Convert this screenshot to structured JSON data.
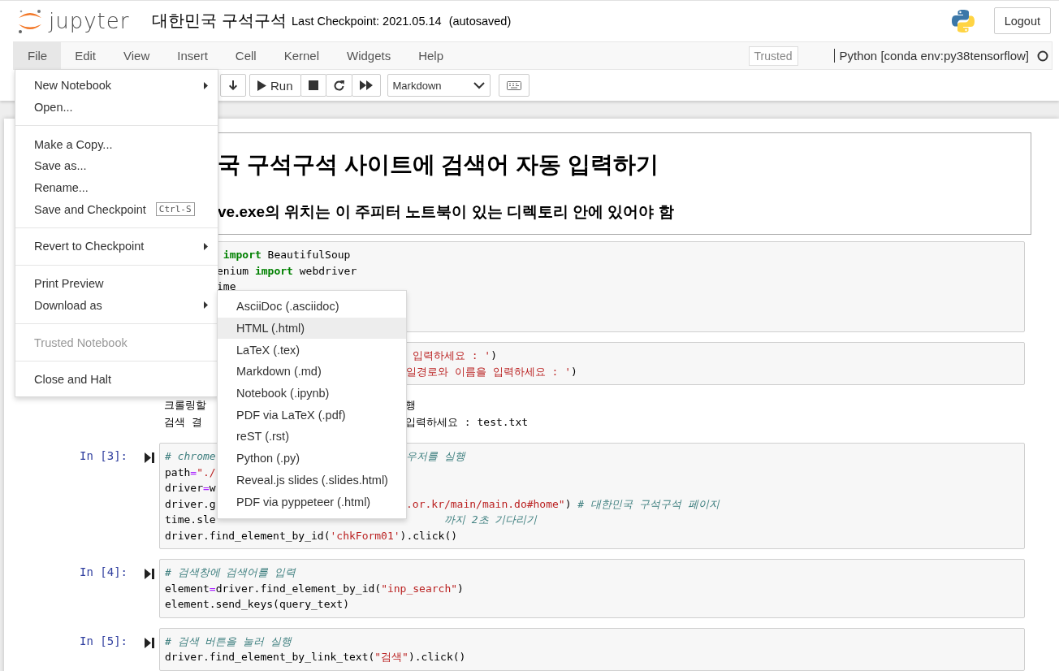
{
  "header": {
    "logo_text": "jupyter",
    "title": "대한민국 구석구석",
    "checkpoint": "Last Checkpoint: 2021.05.14",
    "autosave": "(autosaved)",
    "logout": "Logout"
  },
  "menubar": {
    "items": [
      {
        "label": "File",
        "selected": true
      },
      {
        "label": "Edit",
        "selected": false
      },
      {
        "label": "View",
        "selected": false
      },
      {
        "label": "Insert",
        "selected": false
      },
      {
        "label": "Cell",
        "selected": false
      },
      {
        "label": "Kernel",
        "selected": false
      },
      {
        "label": "Widgets",
        "selected": false
      },
      {
        "label": "Help",
        "selected": false
      }
    ],
    "trusted": "Trusted",
    "kernel": "Python [conda env:py38tensorflow]",
    "kernel_busy": false
  },
  "toolbar": {
    "run_label": "Run",
    "cell_type": "Markdown"
  },
  "cells": [
    {
      "kind": "markdown",
      "headings": [
        {
          "kind": "h1",
          "text": "국 구석구석 사이트에 검색어 자동 입력하기"
        },
        {
          "kind": "h3",
          "text": "ve.exe의 위치는 이 주피터 노트북이 있는 디렉토리 안에 있어야 함"
        }
      ]
    },
    {
      "kind": "code",
      "lines": [
        {
          "after_file_menu": [
            {
              "kind": "keyword",
              "text": " import"
            },
            {
              "kind": "plain",
              "text": " BeautifulSoup"
            }
          ]
        },
        {
          "after_file_menu": [
            {
              "kind": "plain",
              "text": "enium "
            },
            {
              "kind": "keyword",
              "text": "import"
            },
            {
              "kind": "plain",
              "text": " webdriver"
            }
          ]
        },
        {
          "after_file_menu": [
            {
              "kind": "plain",
              "text": "ime"
            }
          ]
        }
      ]
    },
    {
      "kind": "code",
      "lines": [
        {
          "after_submenu": [
            {
              "kind": "string",
              "text": " 입력하세요 : '"
            },
            {
              "kind": "plain",
              "text": ")"
            }
          ]
        },
        {
          "after_submenu": [
            {
              "kind": "string",
              "text": "일경로와 이름을 입력하세요 : '"
            },
            {
              "kind": "plain",
              "text": ")"
            }
          ]
        }
      ]
    },
    {
      "kind": "output",
      "lines": [
        {
          "start": [
            {
              "kind": "plain",
              "text": "크롤링할"
            }
          ],
          "after_submenu": [
            {
              "kind": "plain",
              "text": "행"
            }
          ]
        },
        {
          "start": [
            {
              "kind": "plain",
              "text": "검색 결"
            }
          ],
          "after_submenu": [
            {
              "kind": "plain",
              "text": "입력하세요 : test.txt"
            }
          ]
        }
      ]
    },
    {
      "kind": "code",
      "prompt": "In [3]:",
      "lines": [
        {
          "start": [
            {
              "kind": "comment",
              "text": "# chrome"
            }
          ],
          "after_submenu": [
            {
              "kind": "comment",
              "text": "우저를 실행"
            }
          ]
        },
        {
          "start": [
            {
              "kind": "plain",
              "text": "path"
            },
            {
              "kind": "operator",
              "text": "="
            },
            {
              "kind": "string",
              "text": "\"./"
            }
          ]
        },
        {
          "start": [
            {
              "kind": "plain",
              "text": "driver"
            },
            {
              "kind": "operator",
              "text": "="
            },
            {
              "kind": "plain",
              "text": "w"
            }
          ]
        },
        {
          "start": [
            {
              "kind": "plain",
              "text": "driver.g"
            }
          ],
          "after_submenu": [
            {
              "kind": "string",
              "text": ".or.kr/main/main.do#home\""
            },
            {
              "kind": "plain",
              "text": ") "
            },
            {
              "kind": "comment",
              "text": "# 대한민국 구석구석 페이지"
            }
          ]
        },
        {
          "start": [
            {
              "kind": "plain",
              "text": "time.sle"
            }
          ],
          "after_submenu": [
            {
              "kind": "comment",
              "text": "      까지 2초 기다리기"
            }
          ]
        },
        {
          "start": [
            {
              "kind": "plain",
              "text": "driver.find_element_by_id("
            },
            {
              "kind": "string",
              "text": "'chkForm01'"
            },
            {
              "kind": "plain",
              "text": ").click()"
            }
          ]
        }
      ]
    },
    {
      "kind": "code",
      "prompt": "In [4]:",
      "lines": [
        {
          "start": [
            {
              "kind": "comment",
              "text": "# 검색창에 검색어를 입력"
            }
          ]
        },
        {
          "start": [
            {
              "kind": "plain",
              "text": "element"
            },
            {
              "kind": "operator",
              "text": "="
            },
            {
              "kind": "plain",
              "text": "driver.find_element_by_id("
            },
            {
              "kind": "string",
              "text": "\"inp_search\""
            },
            {
              "kind": "plain",
              "text": ")"
            }
          ]
        },
        {
          "start": [
            {
              "kind": "plain",
              "text": "element.send_keys(query_text)"
            }
          ]
        }
      ]
    },
    {
      "kind": "code",
      "prompt": "In [5]:",
      "lines": [
        {
          "start": [
            {
              "kind": "comment",
              "text": "# 검색 버튼을 눌러 실행"
            }
          ]
        },
        {
          "start": [
            {
              "kind": "plain",
              "text": "driver.find_element_by_link_text("
            },
            {
              "kind": "string",
              "text": "\"검색\""
            },
            {
              "kind": "plain",
              "text": ").click()"
            }
          ]
        }
      ]
    }
  ],
  "file_menu": {
    "groups": [
      [
        {
          "label": "New Notebook",
          "submenu": true,
          "disabled": false
        },
        {
          "label": "Open...",
          "submenu": false,
          "disabled": false
        }
      ],
      [
        {
          "label": "Make a Copy...",
          "submenu": false,
          "disabled": false
        },
        {
          "label": "Save as...",
          "submenu": false,
          "disabled": false
        },
        {
          "label": "Rename...",
          "submenu": false,
          "disabled": false
        },
        {
          "label": "Save and Checkpoint",
          "submenu": false,
          "disabled": false,
          "shortcut": "Ctrl-S"
        }
      ],
      [
        {
          "label": "Revert to Checkpoint",
          "submenu": true,
          "disabled": false
        }
      ],
      [
        {
          "label": "Print Preview",
          "submenu": false,
          "disabled": false
        },
        {
          "label": "Download as",
          "submenu": true,
          "disabled": false
        }
      ],
      [
        {
          "label": "Trusted Notebook",
          "submenu": false,
          "disabled": true
        }
      ],
      [
        {
          "label": "Close and Halt",
          "submenu": false,
          "disabled": false
        }
      ]
    ]
  },
  "download_menu": {
    "items": [
      {
        "label": "AsciiDoc (.asciidoc)",
        "selected": false
      },
      {
        "label": "HTML (.html)",
        "selected": true
      },
      {
        "label": "LaTeX (.tex)",
        "selected": false
      },
      {
        "label": "Markdown (.md)",
        "selected": false
      },
      {
        "label": "Notebook (.ipynb)",
        "selected": false
      },
      {
        "label": "PDF via LaTeX (.pdf)",
        "selected": false
      },
      {
        "label": "reST (.rst)",
        "selected": false
      },
      {
        "label": "Python (.py)",
        "selected": false
      },
      {
        "label": "Reveal.js slides (.slides.html)",
        "selected": false
      },
      {
        "label": "PDF via pyppeteer (.html)",
        "selected": false
      }
    ]
  }
}
